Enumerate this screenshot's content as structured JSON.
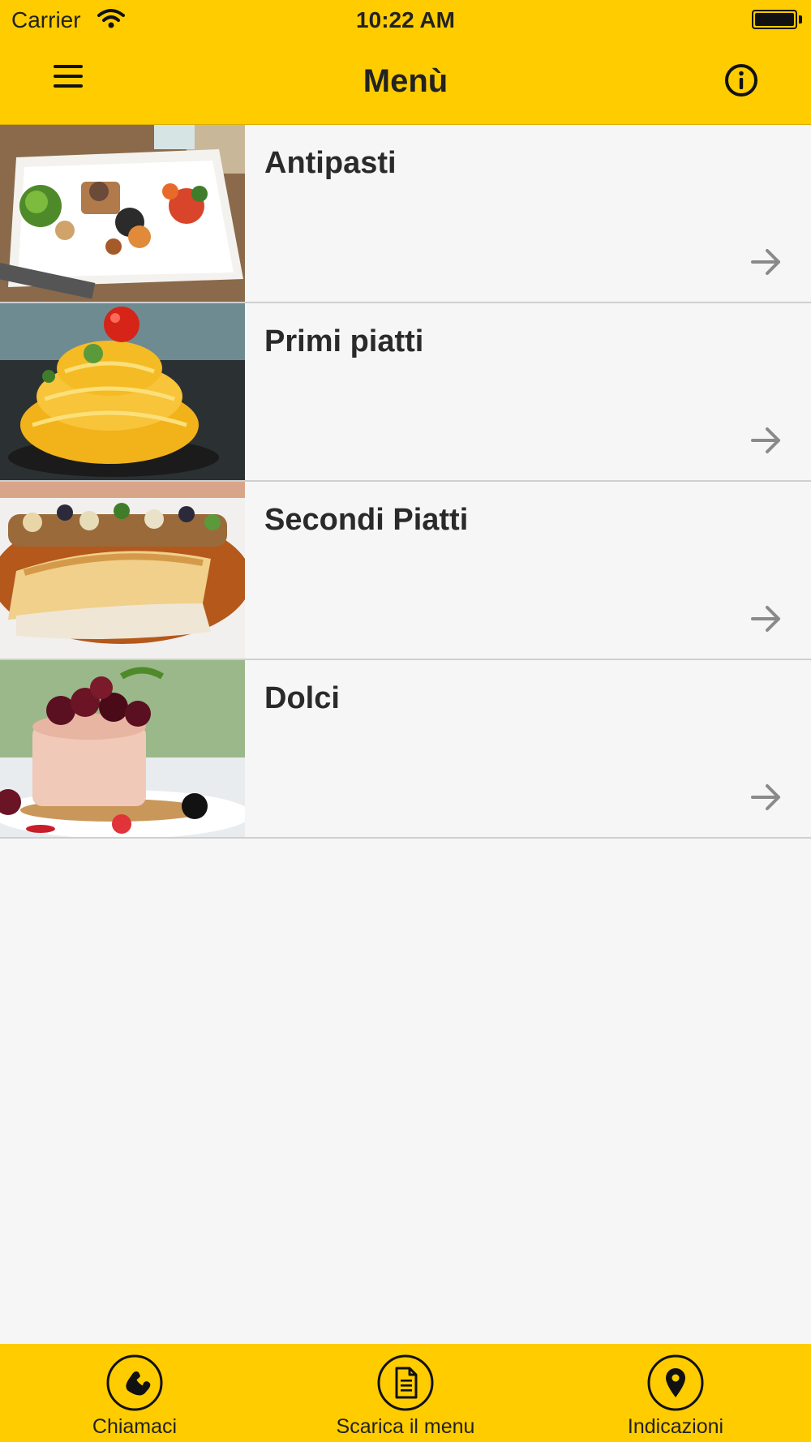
{
  "status_bar": {
    "carrier": "Carrier",
    "time": "10:22 AM"
  },
  "nav": {
    "title": "Menù",
    "menu_icon": "hamburger-icon",
    "info_icon": "info-icon"
  },
  "menu_sections": [
    {
      "label": "Antipasti",
      "image": "antipasti-plate-photo"
    },
    {
      "label": "Primi piatti",
      "image": "spaghetti-tower-photo"
    },
    {
      "label": "Secondi Piatti",
      "image": "grilled-fish-photo"
    },
    {
      "label": "Dolci",
      "image": "cherry-mousse-cake-photo"
    }
  ],
  "tabbar": {
    "items": [
      {
        "label": "Chiamaci",
        "icon": "phone-icon"
      },
      {
        "label": "Scarica il menu",
        "icon": "document-icon"
      },
      {
        "label": "Indicazioni",
        "icon": "map-pin-icon"
      }
    ]
  },
  "colors": {
    "accent": "#ffcc00",
    "background": "#f6f6f6",
    "separator": "#cfcfcf",
    "arrow": "#8a8a8a"
  }
}
